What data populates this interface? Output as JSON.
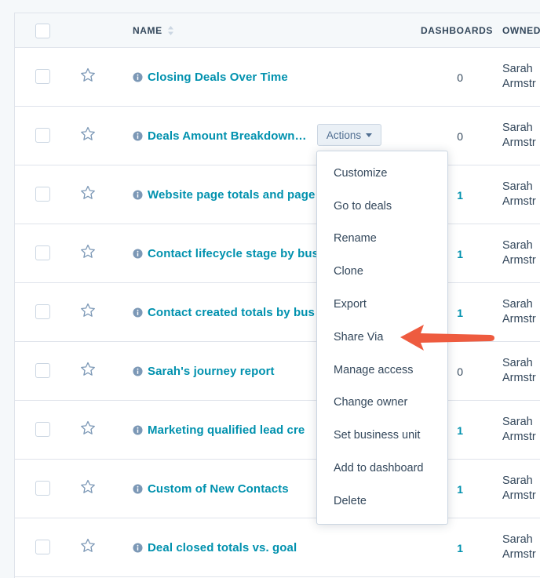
{
  "columns": {
    "name": "NAME",
    "dashboards": "DASHBOARDS",
    "owner": "OWNED"
  },
  "rows": [
    {
      "name": "Closing Deals Over Time",
      "dashboards": "0",
      "owner_first": "Sarah",
      "owner_last": "Armstr"
    },
    {
      "name": "Deals Amount Breakdown…",
      "dashboards": "0",
      "owner_first": "Sarah",
      "owner_last": "Armstr"
    },
    {
      "name": "Website page totals and page",
      "dashboards": "1",
      "owner_first": "Sarah",
      "owner_last": "Armstr"
    },
    {
      "name": "Contact lifecycle stage by bus",
      "dashboards": "1",
      "owner_first": "Sarah",
      "owner_last": "Armstr"
    },
    {
      "name": "Contact created totals by bus",
      "dashboards": "1",
      "owner_first": "Sarah",
      "owner_last": "Armstr"
    },
    {
      "name": "Sarah's journey report",
      "dashboards": "0",
      "owner_first": "Sarah",
      "owner_last": "Armstr"
    },
    {
      "name": "Marketing qualified lead cre",
      "dashboards": "1",
      "owner_first": "Sarah",
      "owner_last": "Armstr"
    },
    {
      "name": "Custom of New Contacts",
      "dashboards": "1",
      "owner_first": "Sarah",
      "owner_last": "Armstr"
    },
    {
      "name": "Deal closed totals vs. goal",
      "dashboards": "1",
      "owner_first": "Sarah",
      "owner_last": "Armstr"
    }
  ],
  "actions_button": {
    "label": "Actions"
  },
  "actions_menu": {
    "items": [
      "Customize",
      "Go to deals",
      "Rename",
      "Clone",
      "Export",
      "Share Via",
      "Manage access",
      "Change owner",
      "Set business unit",
      "Add to dashboard",
      "Delete"
    ]
  },
  "colors": {
    "link": "#0091ae",
    "text": "#33475b",
    "arrow": "#ee5b3f",
    "border": "#dfe3eb"
  },
  "icons": {
    "row_icon": "info-icon",
    "favorite": "star-icon",
    "sort": "sort-icon"
  }
}
